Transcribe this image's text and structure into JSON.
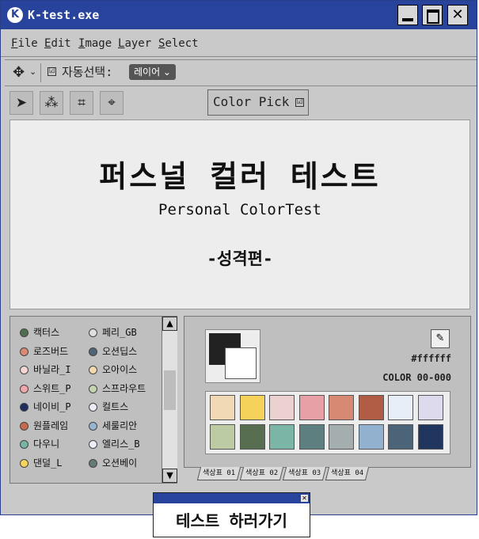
{
  "window": {
    "logo": "K",
    "title": "K-test.exe",
    "min": "",
    "max": "",
    "close": "✕"
  },
  "menu": [
    "File",
    "Edit",
    "Image",
    "Layer",
    "Select"
  ],
  "toolbar": {
    "move_icon": "✥",
    "move_caret": "⌄",
    "auto_check": "☑",
    "auto_label": "자동선택:",
    "layer_value": "레이어 ⌄"
  },
  "tools": [
    {
      "icon": "➤",
      "name": "arrow-tool-icon"
    },
    {
      "icon": "⁂",
      "name": "magic-wand-icon"
    },
    {
      "icon": "⌗",
      "name": "crop-icon"
    },
    {
      "icon": "⌖",
      "name": "crosshair-icon"
    }
  ],
  "color_pick": {
    "label": "Color Pick",
    "check": "☑"
  },
  "canvas": {
    "title": "퍼스널 컬러 테스트",
    "subtitle": "Personal ColorTest",
    "section": "-성격편-"
  },
  "list": [
    {
      "label": "캑터스",
      "color": "#4f6e4f"
    },
    {
      "label": "페리_GB",
      "color": "#dedede"
    },
    {
      "label": "로즈버드",
      "color": "#d98b76"
    },
    {
      "label": "오션딥스",
      "color": "#4e6577"
    },
    {
      "label": "바닐라_I",
      "color": "#f5d7d2"
    },
    {
      "label": "오아이스",
      "color": "#f4d9ae"
    },
    {
      "label": "스위트_P",
      "color": "#f1a6ab"
    },
    {
      "label": "스프라우트",
      "color": "#c6d3b1"
    },
    {
      "label": "네이비_P",
      "color": "#1f2f5e"
    },
    {
      "label": "컬트스",
      "color": "#ecebf6"
    },
    {
      "label": "원플레임",
      "color": "#c46a4f"
    },
    {
      "label": "세룰리안",
      "color": "#96b4d3"
    },
    {
      "label": "다우니",
      "color": "#77b5a6"
    },
    {
      "label": "엘리스_B",
      "color": "#e9eef8"
    },
    {
      "label": "댄덜_L",
      "color": "#f6d35d"
    },
    {
      "label": "오션베이",
      "color": "#647a76"
    }
  ],
  "scroll": {
    "up": "▲",
    "down": "▼"
  },
  "palette": {
    "eyedropper": "✎",
    "hex": "#ffffff",
    "code": "COLOR 00-000",
    "swatches": [
      "#f2d9b6",
      "#f5d25a",
      "#ecd1d1",
      "#e7a1a6",
      "#d78a73",
      "#b05c45",
      "#e8eef7",
      "#dcdaec",
      "#bdcba5",
      "#586e50",
      "#7bb5a6",
      "#5e7f80",
      "#a5aeae",
      "#92b1ce",
      "#4c6478",
      "#21365e"
    ],
    "tabs": [
      "색상표 01",
      "색상표 02",
      "색상표 03",
      "색상표 04"
    ]
  },
  "cta": {
    "close": "✕",
    "label": "테스트 하러가기"
  }
}
